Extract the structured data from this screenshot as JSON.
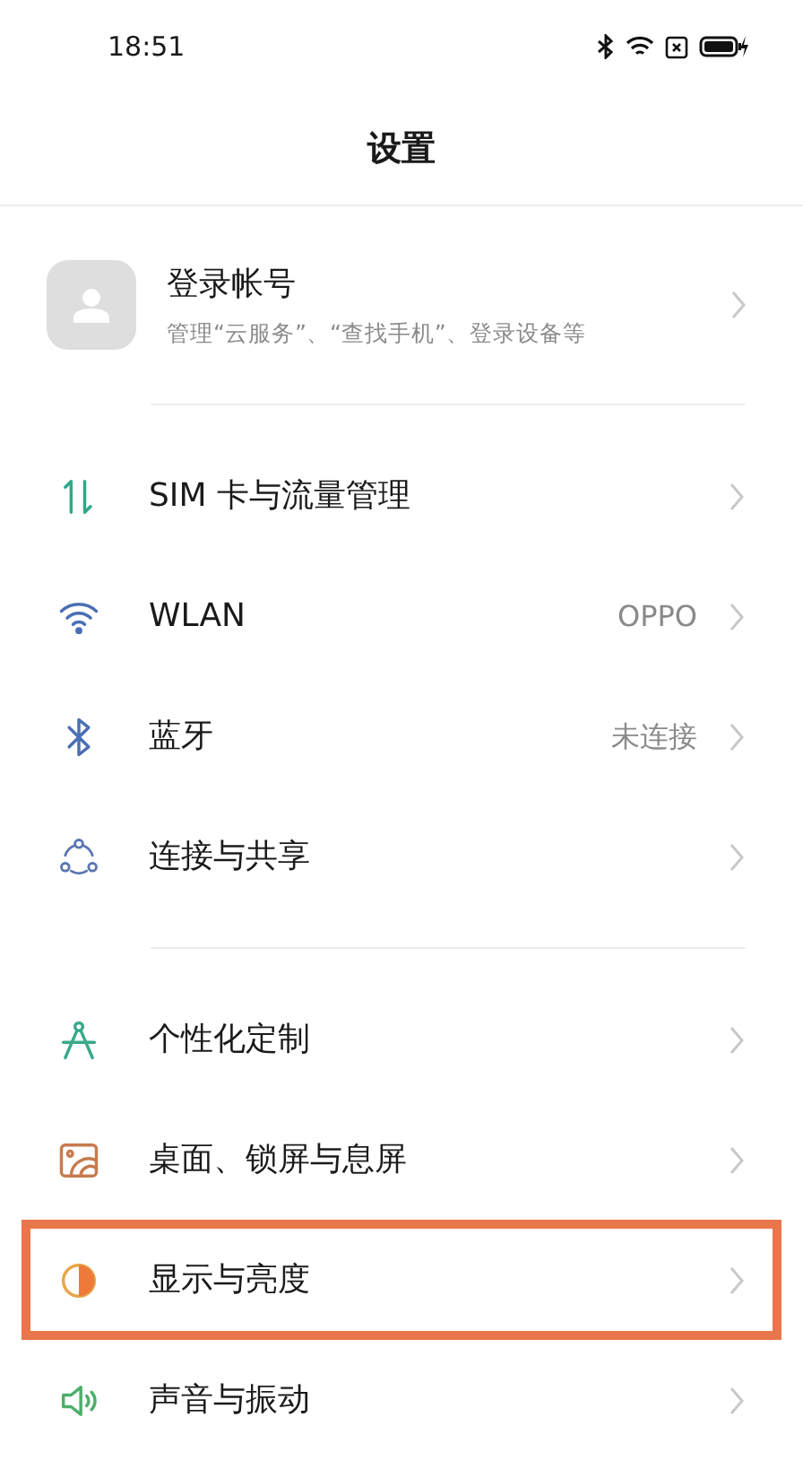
{
  "status_bar": {
    "time": "18:51"
  },
  "title": "设置",
  "account": {
    "name": "登录帐号",
    "subtitle": "管理“云服务”、“查找手机”、登录设备等"
  },
  "sections": [
    {
      "items": [
        {
          "kind": "sim",
          "label": "SIM 卡与流量管理",
          "highlighted": false
        },
        {
          "kind": "wlan",
          "label": "WLAN",
          "value": "OPPO",
          "highlighted": false
        },
        {
          "kind": "bluetooth",
          "label": "蓝牙",
          "value": "未连接",
          "highlighted": false
        },
        {
          "kind": "share",
          "label": "连接与共享",
          "highlighted": false
        }
      ]
    },
    {
      "items": [
        {
          "kind": "personalize",
          "label": "个性化定制",
          "highlighted": false
        },
        {
          "kind": "wallpaper",
          "label": "桌面、锁屏与息屏",
          "highlighted": false
        },
        {
          "kind": "display",
          "label": "显示与亮度",
          "highlighted": true
        },
        {
          "kind": "sound",
          "label": "声音与振动",
          "highlighted": false
        }
      ]
    }
  ]
}
